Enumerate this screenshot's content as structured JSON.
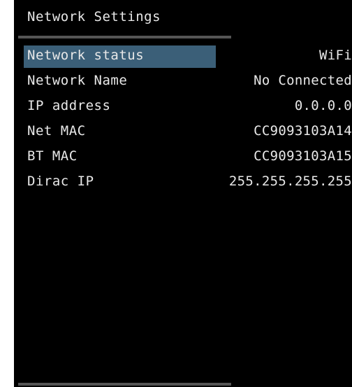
{
  "page": {
    "title": "Network Settings"
  },
  "rows": [
    {
      "label": "Network status",
      "value": "WiFi"
    },
    {
      "label": "Network Name",
      "value": "No Connected"
    },
    {
      "label": "IP address",
      "value": "0.0.0.0"
    },
    {
      "label": "Net MAC",
      "value": "CC9093103A14"
    },
    {
      "label": "BT MAC",
      "value": "CC9093103A15"
    },
    {
      "label": "Dirac IP",
      "value": "255.255.255.255"
    }
  ],
  "colors": {
    "background": "#000000",
    "text": "#e8e8e8",
    "highlight": "#3b5f78",
    "rule": "#555555"
  }
}
